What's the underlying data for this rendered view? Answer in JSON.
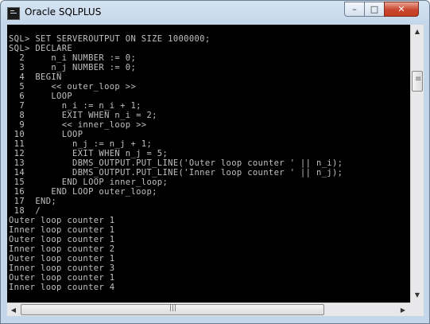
{
  "window": {
    "title": "Oracle SQLPLUS"
  },
  "controls": {
    "minimize": "–",
    "maximize": "□",
    "close": "✕"
  },
  "console_lines": [
    "SQL> SET SERVEROUTPUT ON SIZE 1000000;",
    "SQL> DECLARE",
    "  2     n_i NUMBER := 0;",
    "  3     n_j NUMBER := 0;",
    "  4  BEGIN",
    "  5     << outer_loop >>",
    "  6     LOOP",
    "  7       n_i := n_i + 1;",
    "  8       EXIT WHEN n_i = 2;",
    "  9       << inner_loop >>",
    " 10       LOOP",
    " 11         n_j := n_j + 1;",
    " 12         EXIT WHEN n_j = 5;",
    " 13         DBMS_OUTPUT.PUT_LINE('Outer loop counter ' || n_i);",
    " 14         DBMS_OUTPUT.PUT_LINE('Inner loop counter ' || n_j);",
    " 15       END LOOP inner_loop;",
    " 16     END LOOP outer_loop;",
    " 17  END;",
    " 18  /",
    "Outer loop counter 1",
    "Inner loop counter 1",
    "Outer loop counter 1",
    "Inner loop counter 2",
    "Outer loop counter 1",
    "Inner loop counter 3",
    "Outer loop counter 1",
    "Inner loop counter 4"
  ],
  "scrollbars": {
    "up": "▲",
    "down": "▼",
    "left": "◀",
    "right": "▶"
  }
}
